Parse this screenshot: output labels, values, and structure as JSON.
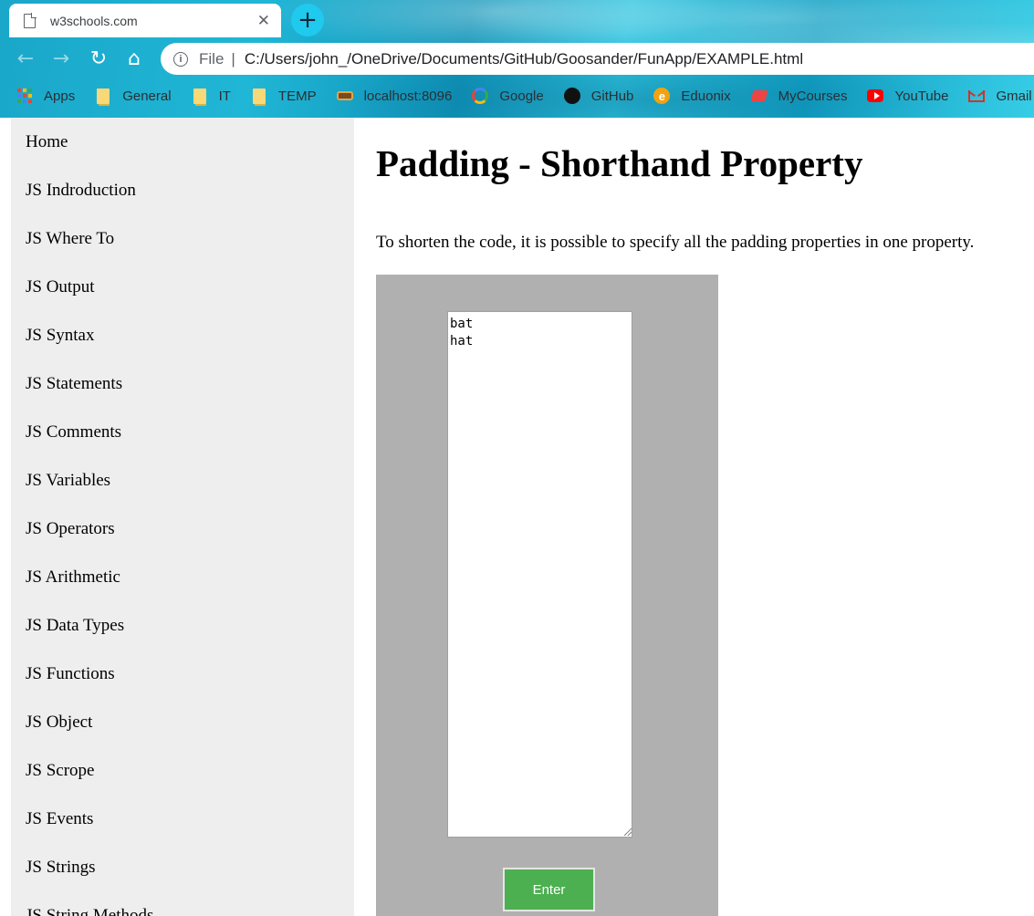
{
  "browser": {
    "tab_title": "w3schools.com",
    "tab_close": "✕",
    "new_tab": "+",
    "nav": {
      "back": "←",
      "forward": "→",
      "reload": "↻",
      "home": "⌂"
    },
    "address": {
      "scheme_label": "File",
      "separator": "|",
      "url": "C:/Users/john_/OneDrive/Documents/GitHub/Goosander/FunApp/EXAMPLE.html"
    },
    "bookmarks": [
      {
        "label": "Apps",
        "icon": "apps-grid-icon"
      },
      {
        "label": "General",
        "icon": "folder-icon"
      },
      {
        "label": "IT",
        "icon": "folder-icon"
      },
      {
        "label": "TEMP",
        "icon": "folder-icon"
      },
      {
        "label": "localhost:8096",
        "icon": "localhost-icon"
      },
      {
        "label": "Google",
        "icon": "google-icon"
      },
      {
        "label": "GitHub",
        "icon": "github-icon"
      },
      {
        "label": "Eduonix",
        "icon": "eduonix-icon"
      },
      {
        "label": "MyCourses",
        "icon": "mycourses-icon"
      },
      {
        "label": "YouTube",
        "icon": "youtube-icon"
      },
      {
        "label": "Gmail - joh",
        "icon": "gmail-icon"
      }
    ]
  },
  "sidebar": {
    "items": [
      "Home",
      "JS Indroduction",
      "JS Where To",
      "JS Output",
      "JS Syntax",
      "JS Statements",
      "JS Comments",
      "JS Variables",
      "JS Operators",
      "JS Arithmetic",
      "JS Data Types",
      "JS Functions",
      "JS Object",
      "JS Scrope",
      "JS Events",
      "JS Strings",
      "JS String Methods"
    ]
  },
  "main": {
    "title": "Padding - Shorthand Property",
    "intro": "To shorten the code, it is possible to specify all the padding properties in one property.",
    "textarea_value": "bat\nhat",
    "enter_label": "Enter"
  },
  "colors": {
    "sidebar_bg": "#eeeeee",
    "demo_bg": "#b0b0b0",
    "button_green": "#4caf50"
  }
}
